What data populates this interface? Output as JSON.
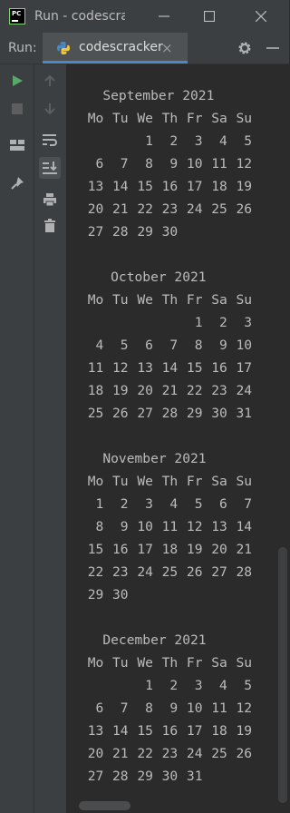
{
  "window": {
    "title": "Run - codescrac",
    "logo_text": "PC"
  },
  "run_panel": {
    "label": "Run:",
    "tab_label": "codescracker",
    "tab_close": "×"
  },
  "colors": {
    "run_green": "#59a869",
    "accent_blue": "#4a88c7",
    "background": "#2b2b2b",
    "chrome": "#3c3f41"
  },
  "icons": [
    "run-icon",
    "stop-icon",
    "layout-icon",
    "pin-icon",
    "up-arrow-icon",
    "down-arrow-icon",
    "soft-wrap-icon",
    "scroll-to-end-icon",
    "print-icon",
    "trash-icon",
    "gear-icon",
    "python-icon"
  ],
  "calendar": {
    "weekdays": [
      "Mo",
      "Tu",
      "We",
      "Th",
      "Fr",
      "Sa",
      "Su"
    ],
    "months": [
      {
        "title": "   September 2021",
        "weeks": [
          [
            "",
            "",
            "1",
            "2",
            "3",
            "4",
            "5"
          ],
          [
            "6",
            "7",
            "8",
            "9",
            "10",
            "11",
            "12"
          ],
          [
            "13",
            "14",
            "15",
            "16",
            "17",
            "18",
            "19"
          ],
          [
            "20",
            "21",
            "22",
            "23",
            "24",
            "25",
            "26"
          ],
          [
            "27",
            "28",
            "29",
            "30",
            "",
            "",
            ""
          ]
        ]
      },
      {
        "title": "    October 2021",
        "weeks": [
          [
            "",
            "",
            "",
            "",
            "1",
            "2",
            "3"
          ],
          [
            "4",
            "5",
            "6",
            "7",
            "8",
            "9",
            "10"
          ],
          [
            "11",
            "12",
            "13",
            "14",
            "15",
            "16",
            "17"
          ],
          [
            "18",
            "19",
            "20",
            "21",
            "22",
            "23",
            "24"
          ],
          [
            "25",
            "26",
            "27",
            "28",
            "29",
            "30",
            "31"
          ]
        ]
      },
      {
        "title": "   November 2021",
        "weeks": [
          [
            "1",
            "2",
            "3",
            "4",
            "5",
            "6",
            "7"
          ],
          [
            "8",
            "9",
            "10",
            "11",
            "12",
            "13",
            "14"
          ],
          [
            "15",
            "16",
            "17",
            "18",
            "19",
            "20",
            "21"
          ],
          [
            "22",
            "23",
            "24",
            "25",
            "26",
            "27",
            "28"
          ],
          [
            "29",
            "30",
            "",
            "",
            "",
            "",
            ""
          ]
        ]
      },
      {
        "title": "   December 2021",
        "weeks": [
          [
            "",
            "",
            "1",
            "2",
            "3",
            "4",
            "5"
          ],
          [
            "6",
            "7",
            "8",
            "9",
            "10",
            "11",
            "12"
          ],
          [
            "13",
            "14",
            "15",
            "16",
            "17",
            "18",
            "19"
          ],
          [
            "20",
            "21",
            "22",
            "23",
            "24",
            "25",
            "26"
          ],
          [
            "27",
            "28",
            "29",
            "30",
            "31",
            "",
            ""
          ]
        ]
      }
    ]
  }
}
